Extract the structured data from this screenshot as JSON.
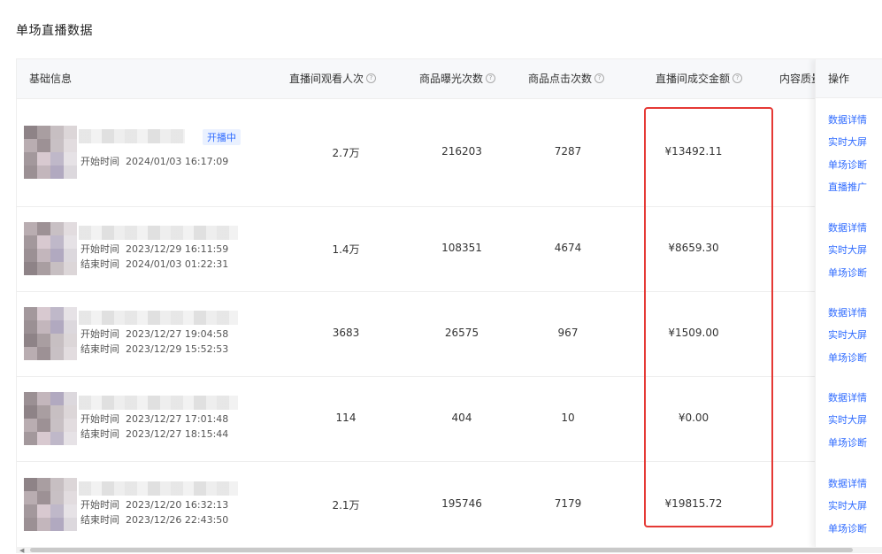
{
  "page": {
    "title": "单场直播数据"
  },
  "table": {
    "columns": {
      "info": "基础信息",
      "viewers": "直播间观看人次",
      "exposures": "商品曝光次数",
      "clicks": "商品点击次数",
      "gmv": "直播间成交金额",
      "content": "内容质量",
      "ops": "操作"
    },
    "help_glyph": "?",
    "rows": [
      {
        "badge": "开播中",
        "start_label": "开始时间",
        "start": "2024/01/03 16:17:09",
        "end_label": "",
        "end": "",
        "viewers": "2.7万",
        "exposures": "216203",
        "clicks": "7287",
        "gmv": "¥13492.11",
        "ops": [
          "数据详情",
          "实时大屏",
          "单场诊断",
          "直播推广"
        ]
      },
      {
        "badge": "",
        "start_label": "开始时间",
        "start": "2023/12/29 16:11:59",
        "end_label": "结束时间",
        "end": "2024/01/03 01:22:31",
        "viewers": "1.4万",
        "exposures": "108351",
        "clicks": "4674",
        "gmv": "¥8659.30",
        "ops": [
          "数据详情",
          "实时大屏",
          "单场诊断"
        ]
      },
      {
        "badge": "",
        "start_label": "开始时间",
        "start": "2023/12/27 19:04:58",
        "end_label": "结束时间",
        "end": "2023/12/29 15:52:53",
        "viewers": "3683",
        "exposures": "26575",
        "clicks": "967",
        "gmv": "¥1509.00",
        "ops": [
          "数据详情",
          "实时大屏",
          "单场诊断"
        ]
      },
      {
        "badge": "",
        "start_label": "开始时间",
        "start": "2023/12/27 17:01:48",
        "end_label": "结束时间",
        "end": "2023/12/27 18:15:44",
        "viewers": "114",
        "exposures": "404",
        "clicks": "10",
        "gmv": "¥0.00",
        "ops": [
          "数据详情",
          "实时大屏",
          "单场诊断"
        ]
      },
      {
        "badge": "",
        "start_label": "开始时间",
        "start": "2023/12/20 16:32:13",
        "end_label": "结束时间",
        "end": "2023/12/26 22:43:50",
        "viewers": "2.1万",
        "exposures": "195746",
        "clicks": "7179",
        "gmv": "¥19815.72",
        "ops": [
          "数据详情",
          "实时大屏",
          "单场诊断"
        ]
      }
    ]
  },
  "colors": {
    "link": "#2f6bff",
    "highlight": "#e53935",
    "header_bg": "#f7f8fa"
  },
  "icons": {
    "help": "question-circle-icon",
    "scroll_left": "caret-left-icon"
  }
}
